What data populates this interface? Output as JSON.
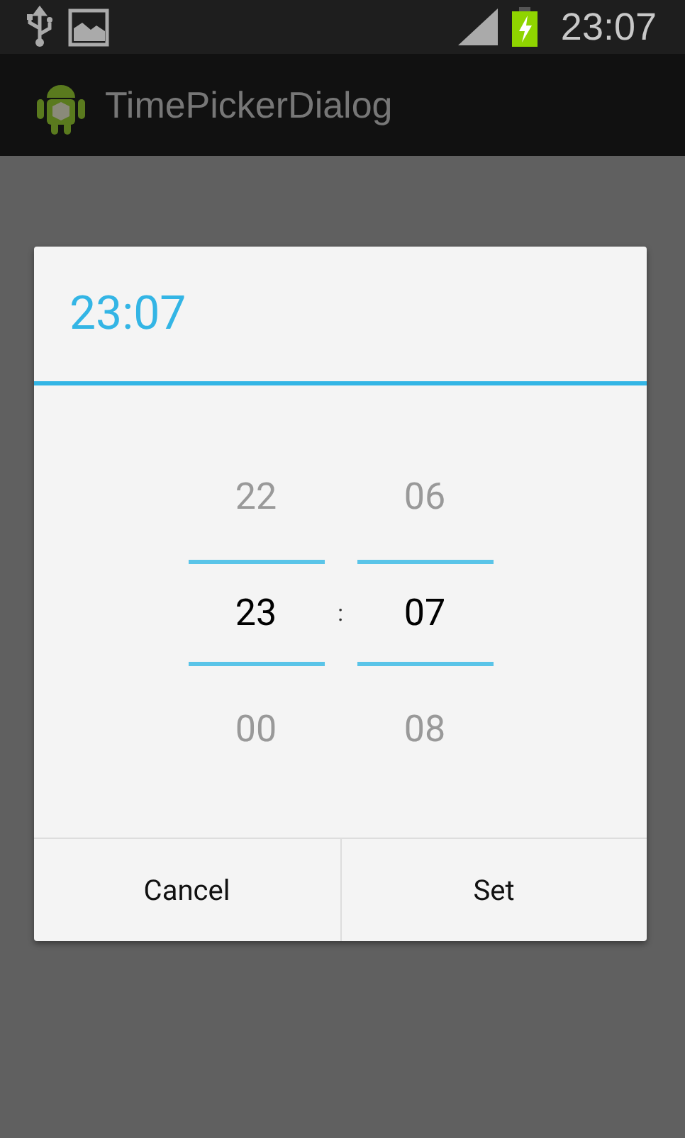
{
  "status_bar": {
    "time": "23:07"
  },
  "action_bar": {
    "title": "TimePickerDialog"
  },
  "dialog": {
    "title": "23:07",
    "pickers": [
      {
        "values": [
          {
            "text": "22",
            "selected": false
          },
          {
            "text": "23",
            "selected": true
          },
          {
            "text": "00",
            "selected": false
          }
        ]
      },
      {
        "values": [
          {
            "text": "06",
            "selected": false
          },
          {
            "text": "07",
            "selected": true
          },
          {
            "text": "08",
            "selected": false
          }
        ]
      }
    ],
    "separator": ":",
    "buttons": [
      "Cancel",
      "Set"
    ]
  }
}
